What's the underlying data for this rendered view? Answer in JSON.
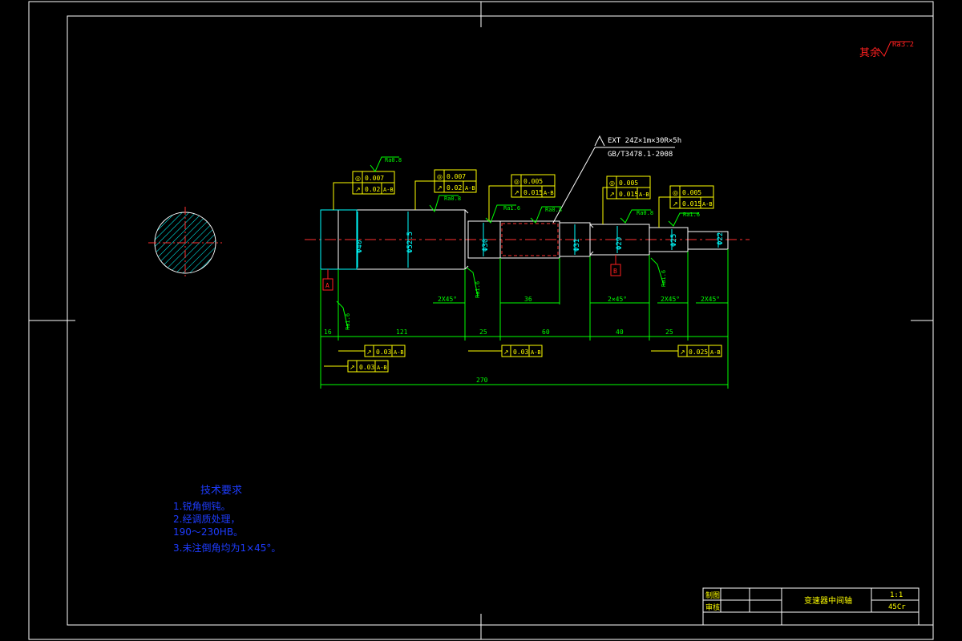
{
  "corner_note": {
    "label": "其余",
    "roughness": "Ra3.2"
  },
  "spline_callout": {
    "spec": "EXT 24Z×1m×30R×5h",
    "standard": "GB/T3478.1-2008"
  },
  "dimensions": {
    "d1": "Φ40",
    "d2": "Φ52.5",
    "d3": "Φ30",
    "d4": "Φ31",
    "d5": "Φ29",
    "d6": "Φ25",
    "d7": "Φ22",
    "len_16": "16",
    "len_121": "121",
    "len_25a": "25",
    "len_60": "60",
    "len_40": "40",
    "len_25b": "25",
    "len_36": "36",
    "total": "270",
    "chamfer_1": "2X45°",
    "chamfer_2": "2×45°",
    "chamfer_3": "2X45°",
    "chamfer_4": "2X45°"
  },
  "roughness_marks": {
    "r1": "Ra0.8",
    "r2": "Ra0.8",
    "r3": "Ra1.6",
    "r4": "Ra0.8",
    "r5": "Ra1.6",
    "r6": "Ra0.8",
    "r7": "Ra1.6",
    "r8": "Ra1.6",
    "r9": "Ra1.6"
  },
  "tolerance_frames": {
    "f1": {
      "row1_sym": "◎",
      "row1_val": "0.007",
      "row1_ref": "",
      "row2_sym": "↗",
      "row2_val": "0.02",
      "row2_ref": "A-B"
    },
    "f2": {
      "row1_sym": "◎",
      "row1_val": "0.007",
      "row1_ref": "",
      "row2_sym": "↗",
      "row2_val": "0.02",
      "row2_ref": "A-B"
    },
    "f3": {
      "row1_sym": "◎",
      "row1_val": "0.005",
      "row1_ref": "",
      "row2_sym": "↗",
      "row2_val": "0.015",
      "row2_ref": "A-B"
    },
    "f4": {
      "row1_sym": "◎",
      "row1_val": "0.005",
      "row1_ref": "",
      "row2_sym": "↗",
      "row2_val": "0.015",
      "row2_ref": "A-B"
    },
    "f5": {
      "row1_sym": "◎",
      "row1_val": "0.005",
      "row1_ref": "",
      "row2_sym": "↗",
      "row2_val": "0.015",
      "row2_ref": "A-B"
    },
    "b1": {
      "sym": "↗",
      "val": "0.03",
      "ref": "A-B"
    },
    "b2": {
      "sym": "↗",
      "val": "0.03",
      "ref": "A-B"
    },
    "b3": {
      "sym": "↗",
      "val": "0.025",
      "ref": "A-B"
    },
    "b4": {
      "sym": "↗",
      "val": "0.03",
      "ref": "A-B"
    }
  },
  "datums": {
    "a": "A",
    "b": "B"
  },
  "tech_requirements": {
    "title": "技术要求",
    "line1": "1.锐角倒钝。",
    "line2": "2.经调质处理，",
    "line3": "190～230HB。",
    "line4": "3.未注倒角均为1×45°。"
  },
  "title_block": {
    "drawn_label": "制图",
    "checked_label": "审核",
    "part_name": "变速器中间轴",
    "scale": "1:1",
    "material": "45Cr"
  },
  "colors": {
    "border": "#ffffff",
    "part_outline": "#ffffff",
    "centerline": "#ff3030",
    "dimension": "#00ff00",
    "annotation": "#ffff00",
    "dim_text": "#00ffff",
    "tech_text": "#1e3cff",
    "corner_red": "#ff2020",
    "hatch": "#00ffff"
  }
}
